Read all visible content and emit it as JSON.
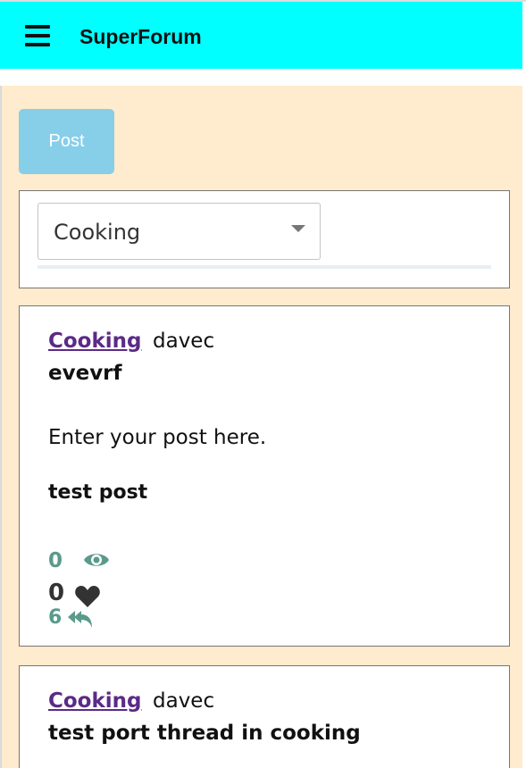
{
  "navbar": {
    "brand": "SuperForum",
    "menu_icon": "hamburger-icon",
    "background": "#00ffff"
  },
  "toolbar": {
    "post_label": "Post"
  },
  "filter": {
    "selected_category": "Cooking"
  },
  "posts": [
    {
      "category": "Cooking",
      "author": "davec",
      "title": "evevrf",
      "body": "Enter your post here.",
      "body_emphasis": "test post",
      "views": "0",
      "likes": "0",
      "replies": "6"
    },
    {
      "category": "Cooking",
      "author": "davec",
      "title": "test port thread in cooking"
    }
  ],
  "colors": {
    "page_background": "#ffebcd",
    "link": "#5b2a86",
    "stat_teal": "#5a9a8a",
    "post_button": "#87cee9"
  }
}
